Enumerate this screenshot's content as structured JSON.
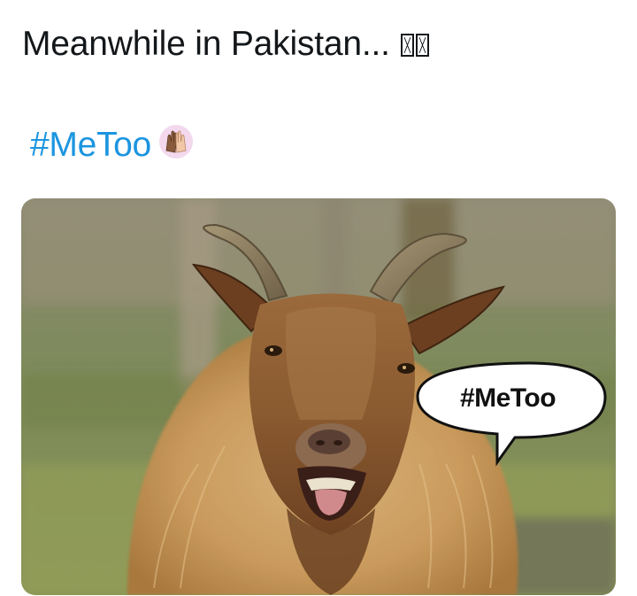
{
  "tweet": {
    "text": "Meanwhile in Pakistan...",
    "trailing_emoji_icons": [
      "missing-glyph-icon",
      "missing-glyph-icon"
    ],
    "hashtag": "#MeToo",
    "hashtag_emoji_icon": "raised-hands-icon",
    "hashtag_color": "#1b95e0"
  },
  "media": {
    "image_icon": "goat-photo",
    "speech_bubble": {
      "text": "#MeToo"
    }
  }
}
